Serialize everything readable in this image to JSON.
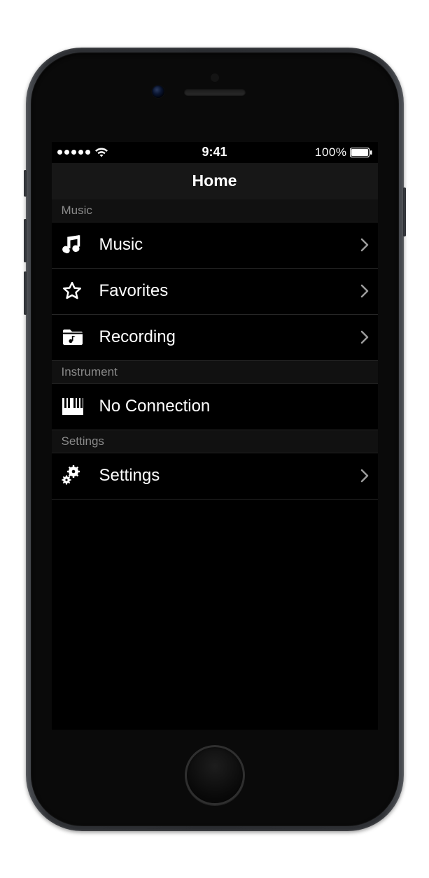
{
  "statusbar": {
    "time": "9:41",
    "battery_text": "100%"
  },
  "navbar": {
    "title": "Home"
  },
  "sections": {
    "music": {
      "header": "Music",
      "items": {
        "music": {
          "label": "Music"
        },
        "favorites": {
          "label": "Favorites"
        },
        "recording": {
          "label": "Recording"
        }
      }
    },
    "instrument": {
      "header": "Instrument",
      "items": {
        "connection": {
          "label": "No Connection"
        }
      }
    },
    "settings": {
      "header": "Settings",
      "items": {
        "settings": {
          "label": "Settings"
        }
      }
    }
  }
}
